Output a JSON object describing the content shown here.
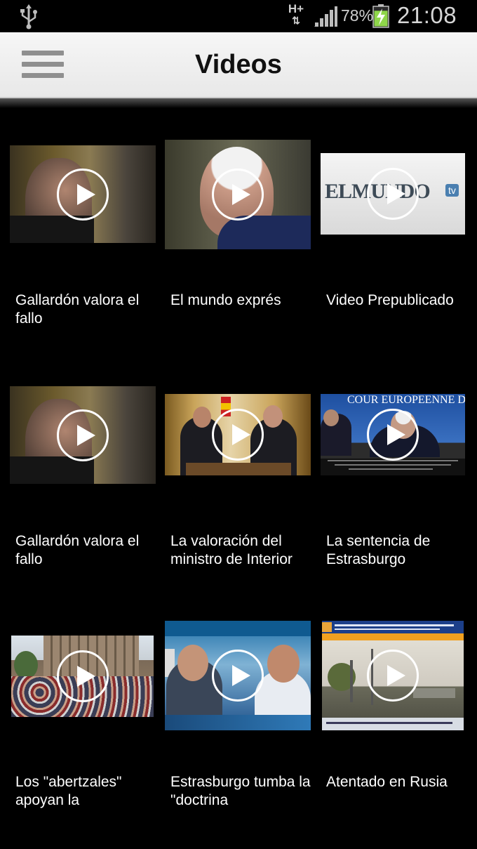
{
  "status_bar": {
    "network": "H+",
    "battery_percent": "78%",
    "time": "21:08",
    "battery_level": 0.78,
    "icons": [
      "usb-icon",
      "network-arrows-icon",
      "signal-icon",
      "battery-charging-icon"
    ]
  },
  "app_bar": {
    "title": "Videos",
    "menu_icon": "hamburger-menu-icon"
  },
  "videos": [
    {
      "title": "Gallardón valora el fallo"
    },
    {
      "title": "El mundo exprés"
    },
    {
      "title": "Video Prepublicado",
      "thumb_text": "ELMUNDO",
      "thumb_badge": "tv"
    },
    {
      "title": "Gallardón valora el fallo"
    },
    {
      "title": "La valoración del ministro de Interior"
    },
    {
      "title": "La sentencia de Estrasburgo",
      "thumb_text": "COUR EUROPEENNE DE"
    },
    {
      "title": "Los \"abertzales\" apoyan la"
    },
    {
      "title": "Estrasburgo tumba la \"doctrina"
    },
    {
      "title": "Atentado en Rusia"
    }
  ],
  "colors": {
    "background": "#000000",
    "app_bar": "#eeeeee",
    "title": "#111111",
    "caption": "#ffffff"
  }
}
